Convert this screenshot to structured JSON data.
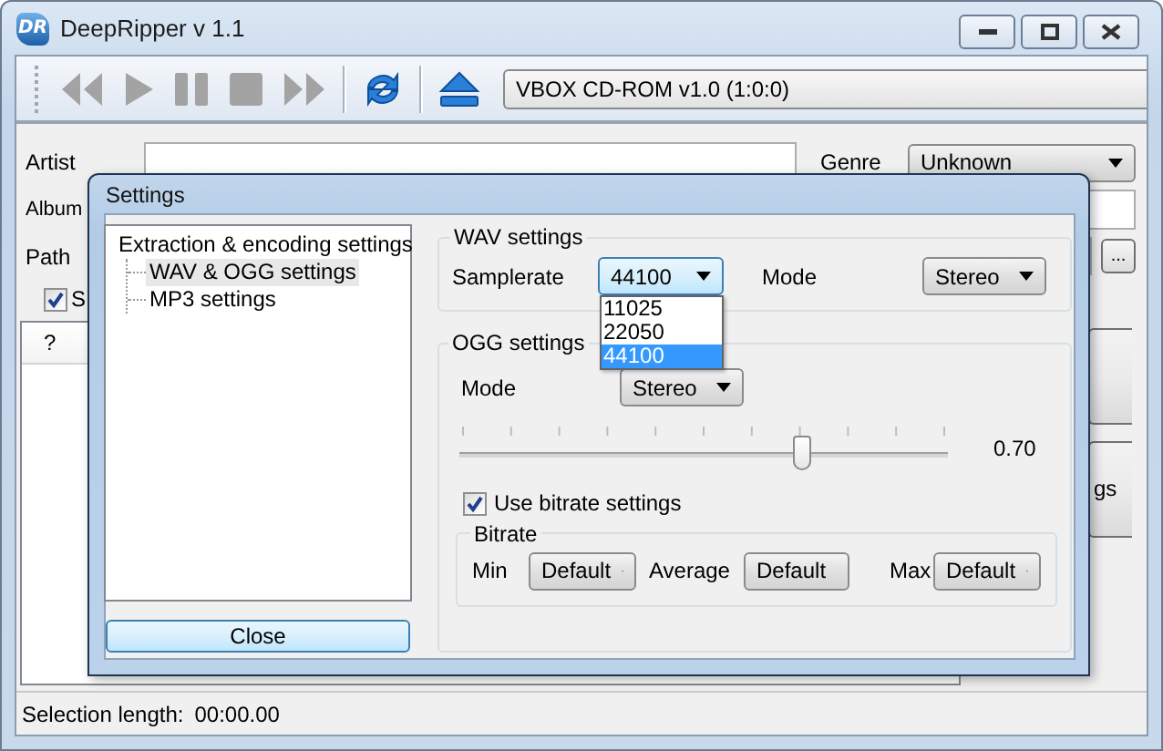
{
  "window": {
    "title": "DeepRipper v 1.1",
    "logo": "DR"
  },
  "toolbar": {
    "buttons": [
      {
        "kind": "previous",
        "disabled": true
      },
      {
        "kind": "play",
        "disabled": true
      },
      {
        "kind": "pause",
        "disabled": true
      },
      {
        "kind": "stop",
        "disabled": true
      },
      {
        "kind": "next",
        "disabled": true
      },
      {
        "kind": "separator"
      },
      {
        "kind": "refresh",
        "disabled": false
      },
      {
        "kind": "separator"
      },
      {
        "kind": "eject",
        "disabled": false
      }
    ],
    "drive": "VBOX CD-ROM v1.0 (1:0:0)"
  },
  "form": {
    "artist_label": "Artist",
    "genre_label": "Genre",
    "genre": "Unknown",
    "album_label": "Album",
    "path_label": "Path",
    "browse_button": "...",
    "checkbox": {
      "label": "S",
      "checked": true
    }
  },
  "track_list": {
    "columns": [
      "?"
    ]
  },
  "side_button_label": "gs",
  "status_bar": {
    "label": "Selection length:",
    "value": "00:00.00"
  },
  "settings": {
    "title": "Settings",
    "tree": [
      {
        "label": "Extraction & encoding settings",
        "selected": false,
        "children": [
          {
            "label": "WAV & OGG settings",
            "selected": true
          },
          {
            "label": "MP3 settings",
            "selected": false
          }
        ]
      }
    ],
    "close_button": "Close",
    "wav": {
      "title": "WAV settings",
      "samplerate_label": "Samplerate",
      "samplerate": {
        "value": "44100",
        "expanded": true,
        "options": [
          {
            "label": "11025",
            "selected": false
          },
          {
            "label": "22050",
            "selected": false
          },
          {
            "label": "44100",
            "selected": true
          }
        ]
      },
      "mode_label": "Mode",
      "mode": "Stereo"
    },
    "ogg": {
      "title": "OGG settings",
      "mode_label": "Mode",
      "mode": "Stereo",
      "quality": {
        "level": 0.7,
        "reading": "0.70"
      },
      "use_bitrate": {
        "label": "Use bitrate settings",
        "checked": true
      },
      "bitrate": {
        "title": "Bitrate",
        "fields": [
          {
            "label": "Min",
            "value": "Default"
          },
          {
            "label": "Average",
            "value": "Default"
          },
          {
            "label": "Max",
            "value": "Default"
          }
        ]
      }
    }
  }
}
